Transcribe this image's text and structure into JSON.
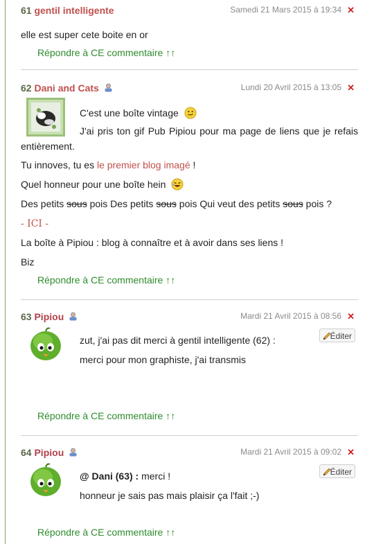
{
  "comments": [
    {
      "number": "61",
      "author": "gentil intelligente",
      "date": "Samedi 21 Mars 2015 à 19:34",
      "text": "elle est super cete boite en or",
      "reply": "Répondre à CE commentaire ↑↑"
    },
    {
      "number": "62",
      "author": "Dani and Cats",
      "date": "Lundi 20 Avril 2015 à 13:05",
      "line1": "C'est une boîte vintage",
      "line2a": "J'ai pris ton gif Pub Pipiou pour ma page de liens que je refais",
      "line2b": "entièrement.",
      "line3_pre": "Tu innoves, tu es ",
      "line3_link": "le premier blog imagé",
      "line3_post": " !",
      "line4": "Quel honneur pour une boîte hein",
      "line5_a": "Des petits ",
      "line5_s1": "sous",
      "line5_b": " pois Des petits ",
      "line5_s2": "sous",
      "line5_c": " pois Qui veut des petits ",
      "line5_s3": "sous",
      "line5_d": " pois ?",
      "line6": "- ICI -",
      "line7": "La boîte à Pipiou : blog à connaître et à avoir dans ses liens !",
      "line8": "Biz",
      "reply": "Répondre à CE commentaire ↑↑"
    },
    {
      "number": "63",
      "author": "Pipiou",
      "date": "Mardi 21 Avril 2015 à 08:56",
      "edit": "Éditer",
      "line1": "zut, j'ai pas dit merci à gentil intelligente (62) :",
      "line2": "merci pour mon graphiste, j'ai transmis",
      "reply": "Répondre à CE commentaire ↑↑"
    },
    {
      "number": "64",
      "author": "Pipiou",
      "date": "Mardi 21 Avril 2015 à 09:02",
      "edit": "Éditer",
      "line1_bold": "@ Dani (63) :",
      "line1_rest": " merci !",
      "line2": "honneur je sais pas mais plaisir ça l'fait ;-)",
      "reply": "Répondre à CE commentaire ↑↑"
    }
  ],
  "icons": {
    "close": "close-icon",
    "user": "user-icon",
    "edit": "pencil-icon"
  }
}
